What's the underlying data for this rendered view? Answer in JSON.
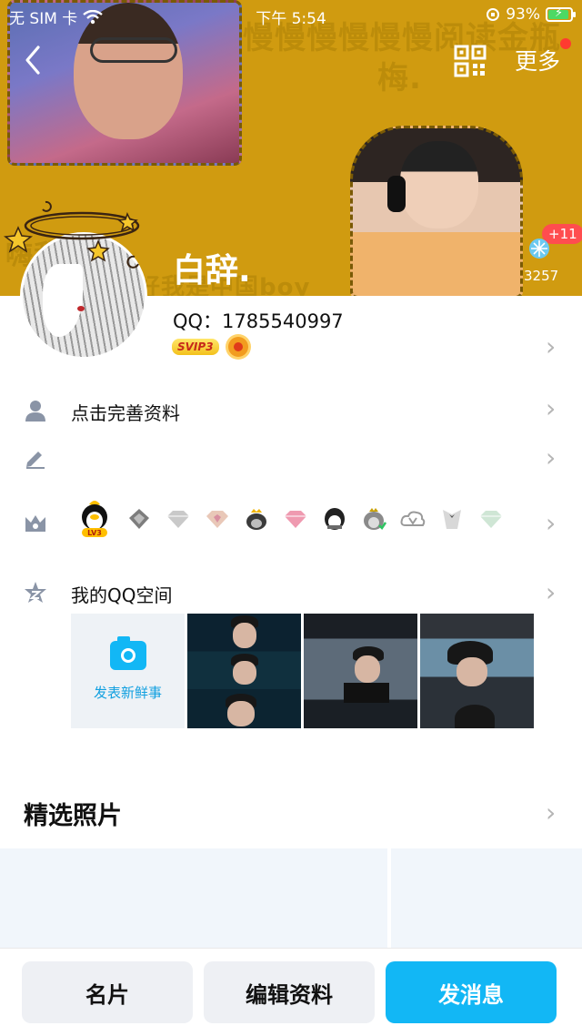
{
  "status_bar": {
    "carrier": "无 SIM 卡",
    "time": "下午 5:54",
    "battery": "93%",
    "battery_level": 0.93
  },
  "header": {
    "more_label": "更多",
    "back_icon": "chevron-left-icon",
    "qr_icon": "qr-code-icon"
  },
  "cover": {
    "text_1": "是慢慢慢慢慢慢阅读金瓶",
    "text_2": "梅.",
    "text_3": "嗨我",
    "text_4": "好我是中国boy",
    "likes_new": "+11",
    "likes_total": "3257"
  },
  "profile": {
    "display_name": "白辞.",
    "qq_number": "QQ：1785540997",
    "vip_badge": "SVIP3"
  },
  "rows": {
    "complete_info": "点击完善资料",
    "signature": "",
    "qzone": "我的QQ空间"
  },
  "medals": [
    "penguin-lv3-icon",
    "silver-medal-icon",
    "diamond-icon",
    "pink-diamond-icon",
    "crown-penguin-icon",
    "pink-gem-icon",
    "penguin-icon",
    "green-penguin-icon",
    "v-cloud-icon",
    "tuxedo-icon",
    "green-diamond-icon"
  ],
  "qzone": {
    "post_label": "发表新鲜事"
  },
  "featured": {
    "title": "精选照片"
  },
  "actions": {
    "card": "名片",
    "edit": "编辑资料",
    "message": "发消息"
  },
  "colors": {
    "accent": "#12b7f5",
    "cover_bg": "#d09b10",
    "badge_red": "#ff4d4f"
  }
}
